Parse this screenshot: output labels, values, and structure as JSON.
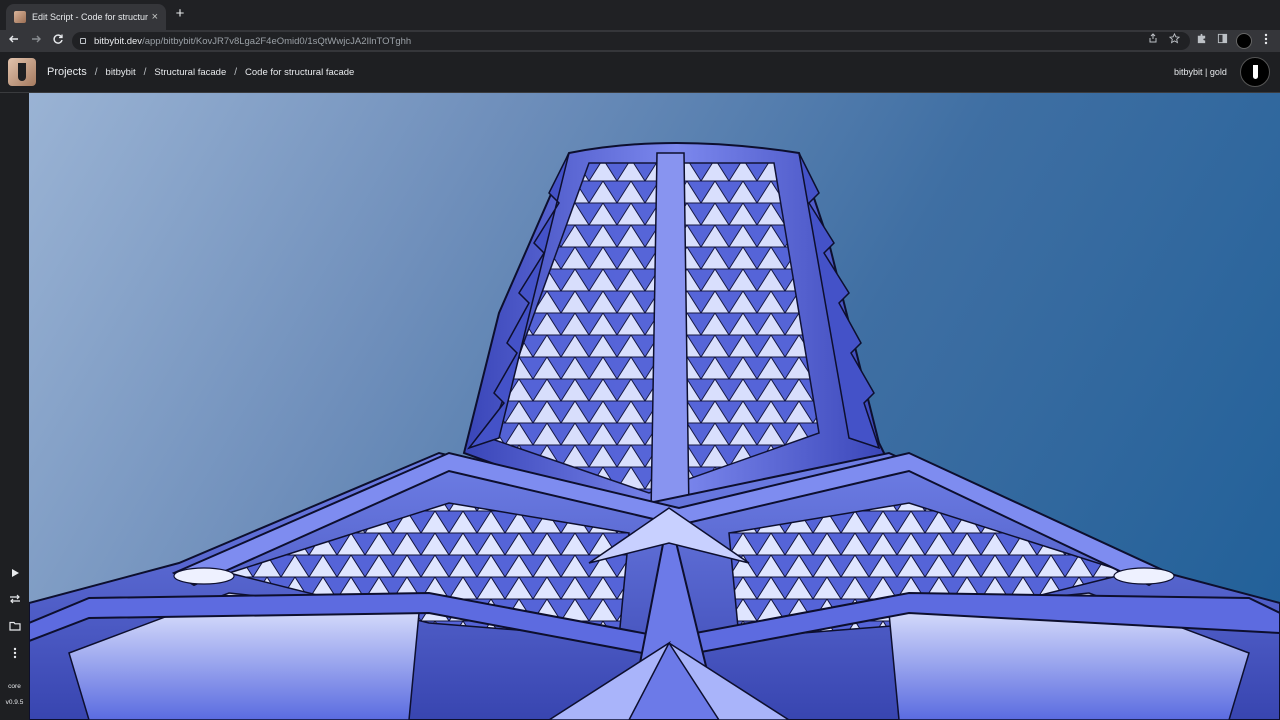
{
  "browser": {
    "tab_title": "Edit Script - Code for structural facade",
    "tab_close": "×",
    "new_tab": "+",
    "url_host": "bitbybit.dev",
    "url_path": "/app/bitbybit/KovJR7v8Lga2F4eOmid0/1sQtWwjcJA2IlnTOTghh"
  },
  "header": {
    "breadcrumb_root": "Projects",
    "breadcrumbs": [
      "bitbybit",
      "Structural facade",
      "Code for structural facade"
    ],
    "separator": "/",
    "account_label": "bitbybit | gold"
  },
  "rail": {
    "core_label": "core",
    "version": "v0.9.5"
  },
  "icons": {
    "back": "arrow-left-icon",
    "forward": "arrow-right-icon",
    "reload": "reload-icon",
    "share": "share-icon",
    "bookmark": "star-icon",
    "extensions": "puzzle-icon",
    "sidepanel": "side-panel-icon",
    "menu": "kebab-menu-icon",
    "run": "play-icon",
    "swap": "swap-icon",
    "folder": "folder-icon",
    "more": "vertical-dots-icon"
  },
  "colors": {
    "chrome_dark": "#202124",
    "app_bar": "#1e1f22",
    "sky_light": "#9ab3d4",
    "sky_dark": "#1f5f98",
    "structure_blue": "#4a5fd0",
    "structure_light": "#c9d2ff"
  }
}
